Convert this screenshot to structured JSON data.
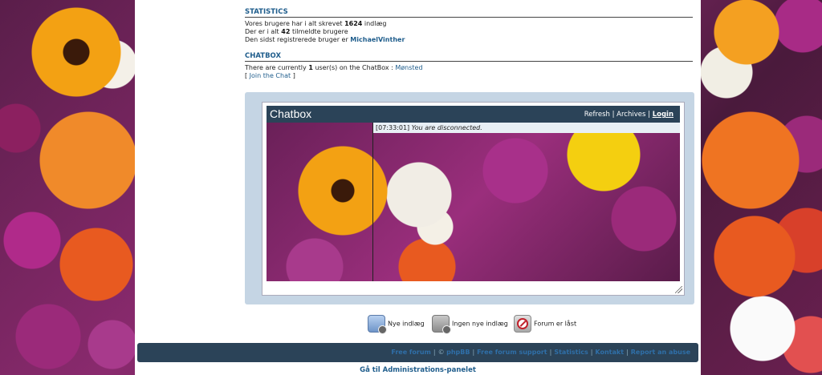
{
  "statistics": {
    "title": "STATISTICS",
    "posts_prefix": "Vores brugere har i alt skrevet",
    "posts_count": "1624",
    "posts_suffix": "indlæg",
    "members_prefix": "Der er i alt",
    "members_count": "42",
    "members_suffix": "tilmeldte brugere",
    "newest_prefix": "Den sidst registrerede bruger er",
    "newest_user": "MichaelVinther"
  },
  "chatbox_section": {
    "title": "CHATBOX",
    "users_prefix": "There are currently",
    "users_count": "1",
    "users_suffix": "user(s) on the ChatBox :",
    "user_name": "Mønsted",
    "join_open": "[",
    "join_label": "Join the Chat",
    "join_close": "]"
  },
  "chatbox": {
    "title": "Chatbox",
    "refresh": "Refresh",
    "archives": "Archives",
    "login": "Login",
    "separator": "|",
    "message_time": "[07:33:01]",
    "message_text": "You are disconnected."
  },
  "legend": {
    "new_posts": "Nye indlæg",
    "no_new_posts": "Ingen nye indlæg",
    "locked": "Forum er låst"
  },
  "footer": {
    "links": [
      "Free forum",
      "©",
      "phpBB",
      "Free forum support",
      "Statistics",
      "Kontakt",
      "Report an abuse"
    ]
  },
  "admin_link": "Gå til Administrations-panelet",
  "colors": {
    "header_bg": "#2b4358",
    "link": "#1f5d8c",
    "chat_frame": "#c5d5e4"
  }
}
